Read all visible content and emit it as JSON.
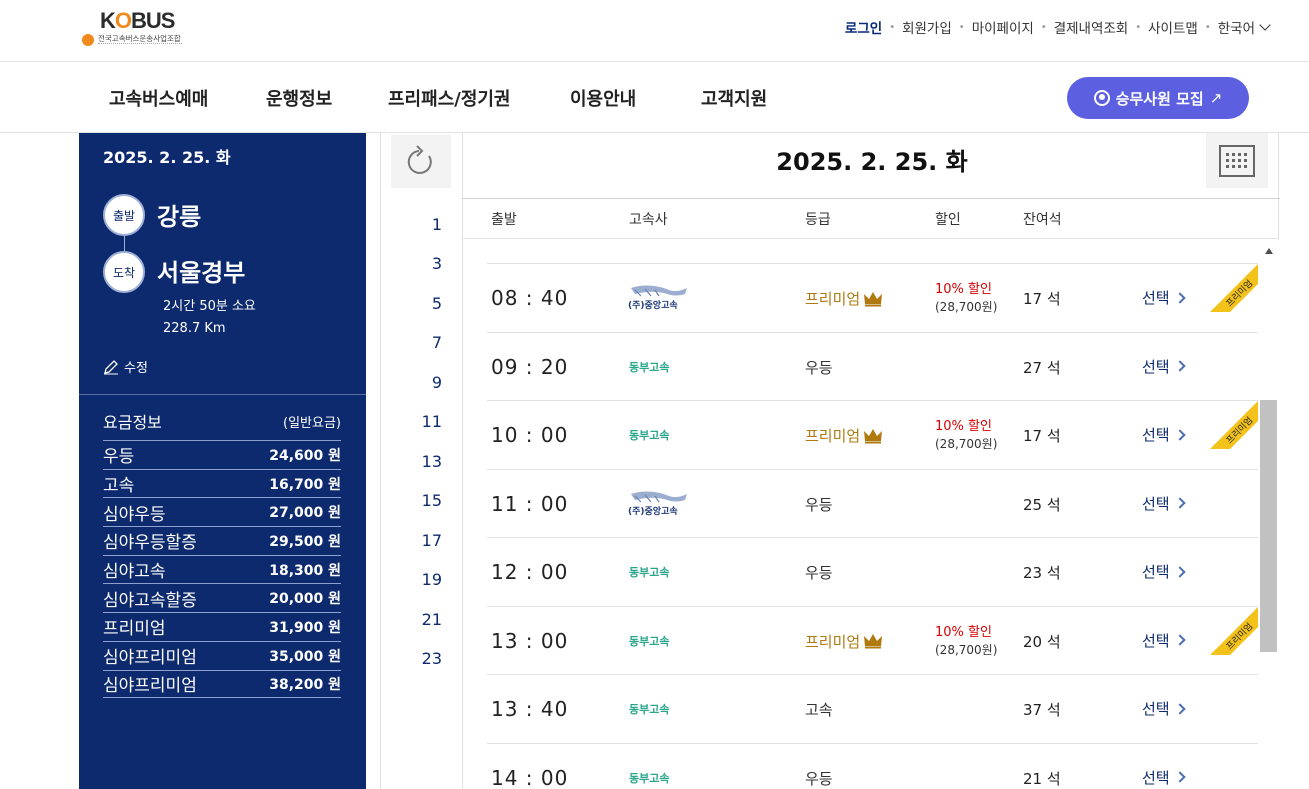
{
  "header": {
    "logo_text_k": "K",
    "logo_text_o": "O",
    "logo_text_bus": "BUS",
    "logo_subtitle": "전국고속버스운송사업조합",
    "util_links": [
      "로그인",
      "회원가입",
      "마이페이지",
      "결제내역조회",
      "사이트맵",
      "한국어"
    ]
  },
  "nav": {
    "menus": [
      "고속버스예매",
      "운행정보",
      "프리패스/정기권",
      "이용안내",
      "고객지원"
    ],
    "recruit_label": "승무사원 모집",
    "recruit_arrow": "↗"
  },
  "route": {
    "date": "2025. 2. 25. 화",
    "depart_tag": "출발",
    "depart_city": "강릉",
    "arrive_tag": "도착",
    "arrive_city": "서울경부",
    "duration": "2시간 50분 소요",
    "distance": "228.7 Km",
    "edit_label": "수정"
  },
  "fares": {
    "title": "요금정보",
    "subtitle": "(일반요금)",
    "items": [
      {
        "name": "우등",
        "price": "24,600 원"
      },
      {
        "name": "고속",
        "price": "16,700 원"
      },
      {
        "name": "심야우등",
        "price": "27,000 원"
      },
      {
        "name": "심야우등할증",
        "price": "29,500 원"
      },
      {
        "name": "심야고속",
        "price": "18,300 원"
      },
      {
        "name": "심야고속할증",
        "price": "20,000 원"
      },
      {
        "name": "프리미엄",
        "price": "31,900 원"
      },
      {
        "name": "심야프리미엄",
        "price": "35,000 원"
      },
      {
        "name": "심야프리미엄",
        "price": "38,200 원"
      }
    ]
  },
  "schedule": {
    "date_title": "2025. 2. 25. 화",
    "hours": [
      "1",
      "3",
      "5",
      "7",
      "9",
      "11",
      "13",
      "15",
      "17",
      "19",
      "21",
      "23"
    ],
    "columns": [
      "출발",
      "고속사",
      "등급",
      "할인",
      "잔여석"
    ],
    "premium_ribbon": "프리미엄",
    "company_logo_text": "(주)중앙고속",
    "rows": [
      {
        "time": "08 : 40",
        "company": "중앙고속",
        "grade": "프리미엄",
        "premium": true,
        "discount": "10% 할인",
        "discount_price": "(28,700원)",
        "seats": "17 석",
        "select": "선택"
      },
      {
        "time": "09 : 20",
        "company": "동부고속",
        "grade": "우등",
        "premium": false,
        "discount": "",
        "discount_price": "",
        "seats": "27 석",
        "select": "선택"
      },
      {
        "time": "10 : 00",
        "company": "동부고속",
        "grade": "프리미엄",
        "premium": true,
        "discount": "10% 할인",
        "discount_price": "(28,700원)",
        "seats": "17 석",
        "select": "선택"
      },
      {
        "time": "11 : 00",
        "company": "중앙고속",
        "grade": "우등",
        "premium": false,
        "discount": "",
        "discount_price": "",
        "seats": "25 석",
        "select": "선택"
      },
      {
        "time": "12 : 00",
        "company": "동부고속",
        "grade": "우등",
        "premium": false,
        "discount": "",
        "discount_price": "",
        "seats": "23 석",
        "select": "선택"
      },
      {
        "time": "13 : 00",
        "company": "동부고속",
        "grade": "프리미엄",
        "premium": true,
        "discount": "10% 할인",
        "discount_price": "(28,700원)",
        "seats": "20 석",
        "select": "선택"
      },
      {
        "time": "13 : 40",
        "company": "동부고속",
        "grade": "고속",
        "premium": false,
        "discount": "",
        "discount_price": "",
        "seats": "37 석",
        "select": "선택"
      },
      {
        "time": "14 : 00",
        "company": "동부고속",
        "grade": "우등",
        "premium": false,
        "discount": "",
        "discount_price": "",
        "seats": "21 석",
        "select": "선택"
      }
    ]
  }
}
